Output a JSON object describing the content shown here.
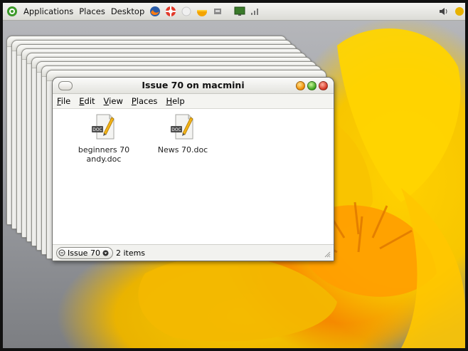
{
  "top_panel": {
    "menus": [
      "Applications",
      "Places",
      "Desktop"
    ]
  },
  "window": {
    "title": "Issue 70 on macmini",
    "menu": [
      {
        "label": "File"
      },
      {
        "label": "Edit"
      },
      {
        "label": "View"
      },
      {
        "label": "Places"
      },
      {
        "label": "Help"
      }
    ],
    "files": [
      {
        "line1": "beginners 70",
        "line2": "andy.doc",
        "icon": "document-icon"
      },
      {
        "line1": "News 70.doc",
        "line2": "",
        "icon": "document-icon"
      }
    ],
    "status": {
      "location": "Issue 70",
      "item_count": "2 items"
    }
  },
  "colors": {
    "panel": "#e6e6e2",
    "flower_yellow": "#f7c600",
    "flower_orange": "#f58a00"
  }
}
